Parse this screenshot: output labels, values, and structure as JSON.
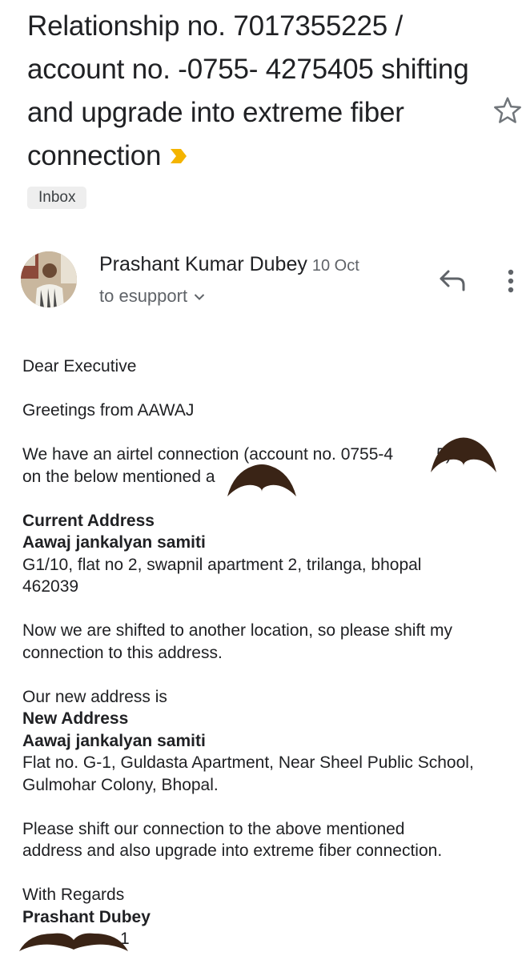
{
  "email": {
    "subject": "Relationship no. 7017355225 / account no. -0755- 4275405 shifting and upgrade into extreme fiber connection",
    "label": "Inbox",
    "important_color": "#f4b400",
    "sender": {
      "name": "Prashant Kumar Dubey",
      "date": "10 Oct",
      "recipient": "to esupport"
    },
    "body": {
      "salutation": "Dear Executive",
      "greeting": "Greetings from AAWAJ",
      "para1_line1": "We have an airtel connection (account no. 0755-4",
      "para1_line1_end": "5)",
      "para1_line2": "on the below mentioned a",
      "para1_line2_end": "s.",
      "current_heading": "Current Address",
      "current_org": "Aawaj jankalyan samiti",
      "current_addr1": "G1/10, flat no 2, swapnil apartment 2, trilanga, bhopal",
      "current_addr2": "462039",
      "shift_line1": "Now we are shifted to another location, so please shift my",
      "shift_line2": "connection to this address.",
      "new_intro": "Our new address is",
      "new_heading": "New Address",
      "new_org": "Aawaj jankalyan samiti",
      "new_addr1": "Flat no. G-1, Guldasta Apartment, Near Sheel Public School,",
      "new_addr2": "Gulmohar Colony, Bhopal.",
      "request_line1": "Please shift our connection to the above mentioned",
      "request_line2": "address and also upgrade into extreme fiber connection.",
      "closing": "With Regards",
      "signature_name": "Prashant Dubey",
      "phone_tail": "1"
    }
  },
  "icons": {
    "star": "star-outline-icon",
    "reply": "reply-icon",
    "more": "more-vert-icon",
    "chevron": "chevron-down-icon",
    "important": "important-marker-icon"
  }
}
